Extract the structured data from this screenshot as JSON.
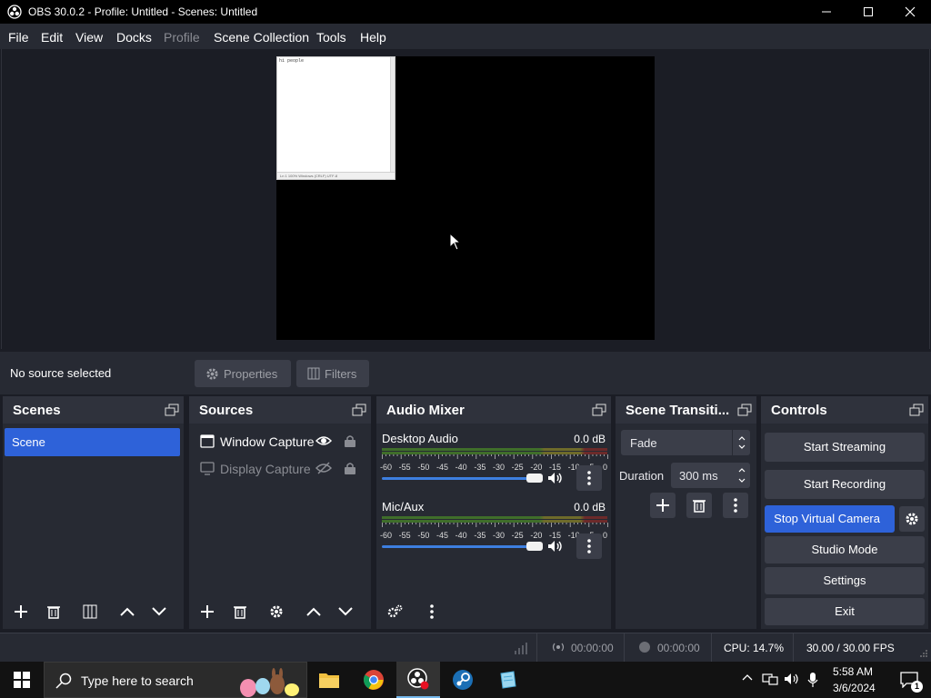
{
  "window": {
    "title": "OBS 30.0.2 - Profile: Untitled - Scenes: Untitled"
  },
  "menu": [
    "File",
    "Edit",
    "View",
    "Docks",
    "Profile",
    "Scene Collection",
    "Tools",
    "Help"
  ],
  "preview": {
    "notepad_text": "hi people",
    "notepad_status": "Ln 1 100%  Windows (CRLF)  UTF-8"
  },
  "sourcebar": {
    "no_source": "No source selected",
    "properties": "Properties",
    "filters": "Filters"
  },
  "scenes": {
    "title": "Scenes",
    "items": [
      "Scene"
    ]
  },
  "sources": {
    "title": "Sources",
    "items": [
      {
        "name": "Window Capture",
        "visible": true,
        "locked": false
      },
      {
        "name": "Display Capture",
        "visible": false,
        "locked": false
      }
    ]
  },
  "audio_mixer": {
    "title": "Audio Mixer",
    "meter_scale": [
      "-60",
      "-55",
      "-50",
      "-45",
      "-40",
      "-35",
      "-30",
      "-25",
      "-20",
      "-15",
      "-10",
      "-5",
      "0"
    ],
    "channels": [
      {
        "name": "Desktop Audio",
        "level": "0.0 dB",
        "volume_fraction": 1.0
      },
      {
        "name": "Mic/Aux",
        "level": "0.0 dB",
        "volume_fraction": 1.0
      }
    ]
  },
  "transitions": {
    "title": "Scene Transiti...",
    "selected": "Fade",
    "duration_label": "Duration",
    "duration_value": "300 ms"
  },
  "controls": {
    "title": "Controls",
    "start_streaming": "Start Streaming",
    "start_recording": "Start Recording",
    "virtual_camera": "Stop Virtual Camera",
    "studio_mode": "Studio Mode",
    "settings": "Settings",
    "exit": "Exit"
  },
  "status": {
    "stream_time": "00:00:00",
    "record_time": "00:00:00",
    "cpu": "CPU: 14.7%",
    "fps": "30.00 / 30.00 FPS"
  },
  "taskbar": {
    "search_placeholder": "Type here to search",
    "time": "5:58 AM",
    "date": "3/6/2024",
    "notification_count": "1"
  },
  "colors": {
    "accent": "#2e62d9",
    "dock_bg": "#272a33",
    "app_bg": "#1b1d25"
  }
}
